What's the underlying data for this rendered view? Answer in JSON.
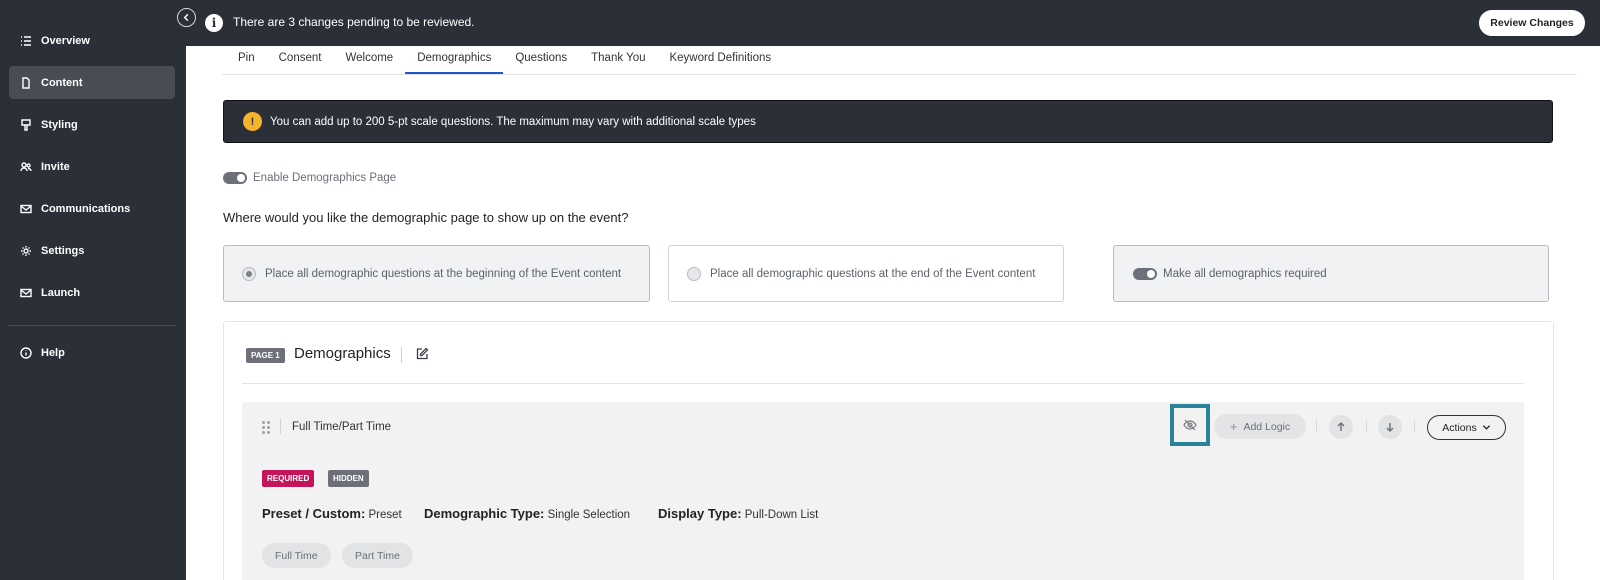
{
  "sidebar": {
    "items": [
      {
        "label": "Overview",
        "icon": "list-icon"
      },
      {
        "label": "Content",
        "icon": "document-icon",
        "active": true
      },
      {
        "label": "Styling",
        "icon": "brush-icon"
      },
      {
        "label": "Invite",
        "icon": "users-icon"
      },
      {
        "label": "Communications",
        "icon": "mail-icon"
      },
      {
        "label": "Settings",
        "icon": "gear-icon"
      },
      {
        "label": "Launch",
        "icon": "mail-icon"
      },
      {
        "label": "Help",
        "icon": "info-circle-icon"
      }
    ]
  },
  "banner": {
    "message": "There are 3 changes pending to be reviewed.",
    "review_button": "Review Changes",
    "info_glyph": "i"
  },
  "tabs": [
    "Pin",
    "Consent",
    "Welcome",
    "Demographics",
    "Questions",
    "Thank You",
    "Keyword Definitions"
  ],
  "active_tab": "Demographics",
  "notice": {
    "glyph": "!",
    "text": "You can add up to 200 5-pt scale questions. The maximum may vary with additional scale types"
  },
  "enable_demographics": {
    "label": "Enable Demographics Page",
    "on": true
  },
  "placement_question": "Where would you like the demographic page to show up on the event?",
  "placement_options": [
    {
      "label": "Place all demographic questions at the beginning of the Event content",
      "selected": true
    },
    {
      "label": "Place all demographic questions at the end of the Event content",
      "selected": false
    }
  ],
  "require_all": {
    "label": "Make all demographics required",
    "on": true
  },
  "page": {
    "badge": "PAGE 1",
    "title": "Demographics",
    "question": {
      "name": "Full Time/Part Time",
      "add_logic": "Add Logic",
      "actions": "Actions",
      "badges": {
        "required": "REQUIRED",
        "hidden": "HIDDEN"
      },
      "preset_label": "Preset / Custom:",
      "preset_value": "Preset",
      "type_label": "Demographic Type:",
      "type_value": "Single Selection",
      "display_label": "Display Type:",
      "display_value": "Pull-Down List",
      "options": [
        "Full Time",
        "Part Time"
      ]
    }
  },
  "colors": {
    "sidebar_bg": "#2b2f38",
    "active_tab_underline": "#1f58c6",
    "warning": "#f4b42b",
    "required_badge": "#c4145a",
    "hidden_badge": "#6d7079",
    "focus_outline": "#2a8398"
  }
}
